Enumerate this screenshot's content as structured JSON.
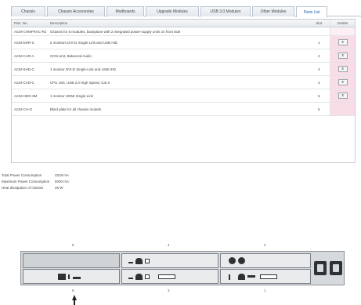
{
  "tabs": [
    {
      "label": "Chassis"
    },
    {
      "label": "Chassis Accessories"
    },
    {
      "label": "Modboards"
    },
    {
      "label": "Upgrade Modules"
    },
    {
      "label": "USB 3.0 Modules"
    },
    {
      "label": "Other Modules"
    },
    {
      "label": "Parts List"
    }
  ],
  "table": {
    "headers": {
      "part": "Part. No.",
      "desc": "Description",
      "slot": "Slot",
      "delete": "Delete"
    },
    "rows": [
      {
        "part": "ACM-CHMFRAC-R2",
        "desc": "Chassis for 6 modules, backplane with 2 integrated power-supply units on front side",
        "slot": "",
        "delete": ""
      },
      {
        "part": "ACM-DHR-C",
        "desc": "2 monitors DVI-D Single-Link and USB HID",
        "slot": "1",
        "delete": "x"
      },
      {
        "part": "ACM-CAR-A",
        "desc": "CON Unit, Balanced Audio",
        "slot": "2",
        "delete": "x"
      },
      {
        "part": "ACM-SHD-C",
        "desc": "1 monitor DVI-D Single-Link and USB HID",
        "slot": "3",
        "delete": "x"
      },
      {
        "part": "ACM-CVD-C",
        "desc": "CPU Unit, USB 2.0 High Speed, Cat X",
        "slot": "4",
        "delete": "x"
      },
      {
        "part": "ACM-HDO-3M",
        "desc": "1 monitor HDMI Single-Link",
        "slot": "5",
        "delete": "x"
      },
      {
        "part": "ACM-CH-O",
        "desc": "Blind plate for all chassis models",
        "slot": "6",
        "delete": ""
      }
    ]
  },
  "stats": [
    {
      "label": "Total Power Consumption",
      "value": "3318 mA"
    },
    {
      "label": "Maximum Power Consumption",
      "value": "5000 mA"
    },
    {
      "label": "Heat dissipation of chassis",
      "value": "26 W"
    }
  ],
  "slots": {
    "top": [
      "6",
      "4",
      "2"
    ],
    "bottom": [
      "5",
      "3",
      "1"
    ]
  },
  "colors": {
    "accent": "#1f5fa8",
    "delete_column": "#f9dde6",
    "chassis": "#d7dadd"
  }
}
